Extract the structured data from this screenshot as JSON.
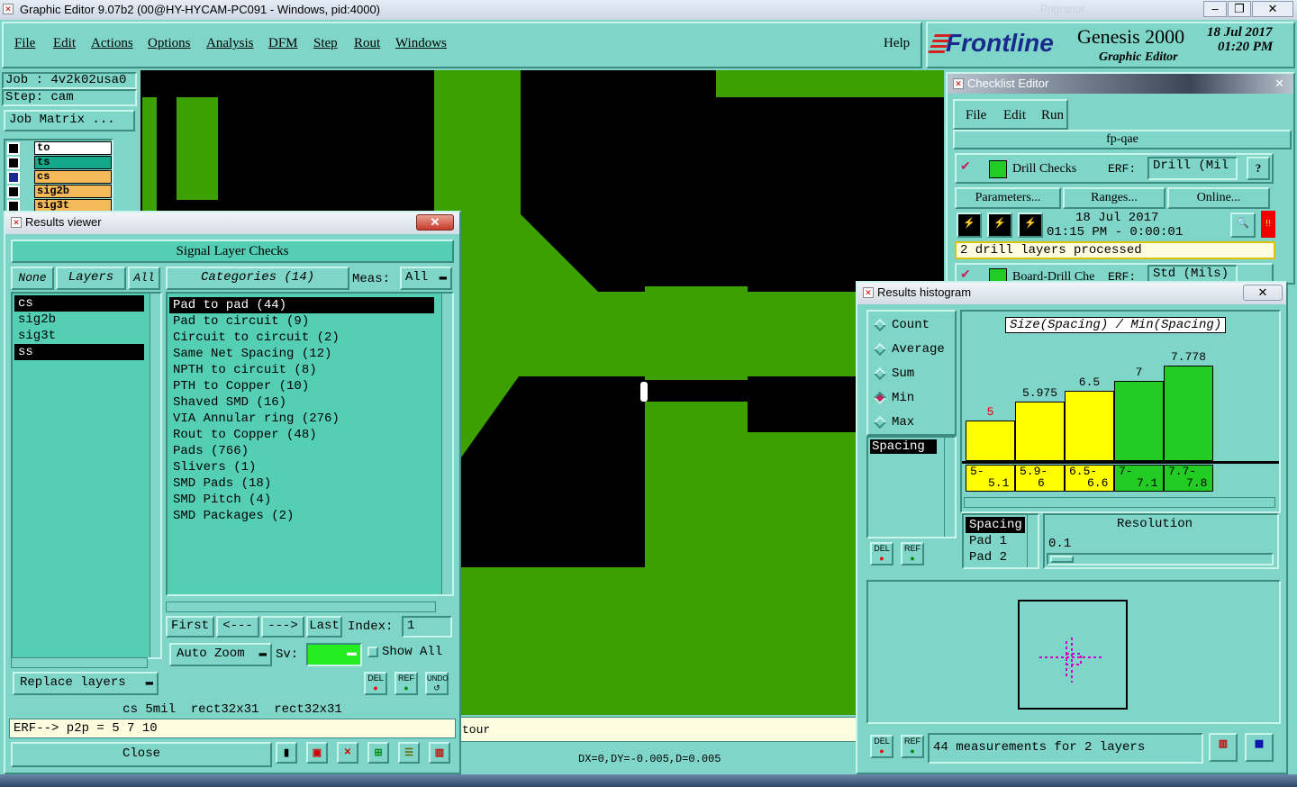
{
  "app": {
    "title": "Graphic Editor 9.07b2 (00@HY-HYCAM-PC091 - Windows, pid:4000)",
    "faded_right": "Prigranot"
  },
  "menu": {
    "items": [
      "File",
      "Edit",
      "Actions",
      "Options",
      "Analysis",
      "DFM",
      "Step",
      "Rout",
      "Windows"
    ],
    "help": "Help"
  },
  "brand": {
    "logo": "Frontline",
    "product": "Genesis 2000",
    "subtitle": "Graphic Editor",
    "date": "18 Jul 2017",
    "time": "01:20 PM"
  },
  "job": {
    "job": "Job : 4v2k02usa0",
    "step": "Step: cam",
    "matrix_btn": "Job Matrix ..."
  },
  "layers_panel": {
    "layers": [
      {
        "name": "to",
        "color": "#ffffff"
      },
      {
        "name": "ts",
        "color": "#12a888"
      },
      {
        "name": "cs",
        "color": "#f5b95a"
      },
      {
        "name": "sig2b",
        "color": "#f5b95a"
      },
      {
        "name": "sig3t",
        "color": "#f5b95a"
      }
    ]
  },
  "results_viewer": {
    "title": "Results viewer",
    "header": "Signal Layer Checks",
    "none_btn": "None",
    "layers_btn": "Layers",
    "all_btn": "All",
    "categories_btn": "Categories (14)",
    "meas_label": "Meas:",
    "meas_value": "All",
    "layer_list": [
      "cs",
      "sig2b",
      "sig3t",
      "ss"
    ],
    "categories": [
      "Pad to pad (44)",
      "Pad to circuit (9)",
      "Circuit to circuit (2)",
      "Same Net Spacing (12)",
      "NPTH to circuit (8)",
      "PTH to Copper (10)",
      "Shaved SMD (16)",
      "VIA Annular ring (276)",
      "Rout to Copper (48)",
      "Pads (766)",
      "Slivers (1)",
      "SMD Pads (18)",
      "SMD Pitch (4)",
      "SMD Packages (2)"
    ],
    "nav": {
      "first": "First",
      "prev": "<---",
      "next": "--->",
      "last": "Last",
      "index_label": "Index:",
      "index_value": "1"
    },
    "auto_zoom": "Auto Zoom",
    "sv_label": "Sv:",
    "show_all": "Show All",
    "replace_layers": "Replace layers",
    "del": "DEL",
    "ref": "REF",
    "undo": "UNDO",
    "info_line": "cs 5mil  rect32x31  rect32x31",
    "erf_line": "ERF--> p2p = 5 7 10",
    "close": "Close"
  },
  "status": {
    "contour": "tour",
    "delta": "DX=0,DY=-0.005,D=0.005"
  },
  "checklist": {
    "title": "Checklist Editor",
    "menu": [
      "File",
      "Edit",
      "Run"
    ],
    "name": "fp-qae",
    "row1_name": "Drill Checks",
    "erf_label": "ERF:",
    "row1_erf": "Drill (Mil",
    "q": "?",
    "params": "Parameters...",
    "ranges": "Ranges...",
    "online": "Online...",
    "date": "18 Jul 2017",
    "time": "01:15 PM - 0:00:01",
    "status": "2 drill layers processed",
    "row2_name": "Board-Drill Che",
    "row2_erf": "Std (Mils)"
  },
  "histogram": {
    "title": "Results histogram",
    "modes": [
      "Count",
      "Average",
      "Sum",
      "Min",
      "Max"
    ],
    "selected_mode": "Min",
    "chart_title": "Size(Spacing) / Min(Spacing)",
    "meas_list": [
      "Spacing"
    ],
    "detail_list": [
      "Spacing",
      "Pad 1",
      "Pad 2"
    ],
    "resolution_label": "Resolution",
    "resolution_value": "0.1",
    "summary": "44 measurements for 2 layers",
    "del": "DEL",
    "ref": "REF"
  },
  "chart_data": {
    "type": "bar",
    "title": "Size(Spacing) / Min(Spacing)",
    "categories": [
      "5-\n5.1",
      "5.9-\n6",
      "6.5-\n6.6",
      "7-\n7.1",
      "7.7-\n7.8"
    ],
    "category_labels_top": [
      "5-",
      "5.9-",
      "6.5-",
      "7-",
      "7.7-"
    ],
    "category_labels_bottom": [
      "5.1",
      "6",
      "6.6",
      "7.1",
      "7.8"
    ],
    "values": [
      5,
      5.975,
      6.5,
      7,
      7.778
    ],
    "value_labels": [
      "5",
      "5.975",
      "6.5",
      "7",
      "7.778"
    ],
    "colors": [
      "#ffff00",
      "#ffff00",
      "#ffff00",
      "#22cc22",
      "#22cc22"
    ],
    "label_colors": [
      "#e00000",
      "#000000",
      "#000000",
      "#000000",
      "#000000"
    ]
  }
}
